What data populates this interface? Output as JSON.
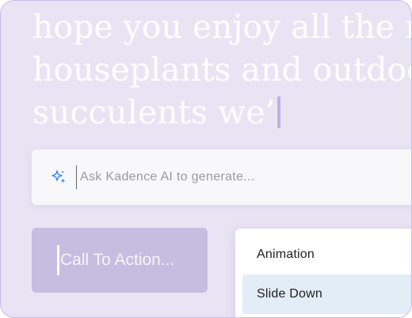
{
  "headline": {
    "lines": [
      "hope you enjoy all the new",
      "houseplants and outdoor",
      "succulents we’"
    ]
  },
  "ai_bar": {
    "icon": "sparkle-icon",
    "placeholder": "Ask Kadence AI to generate..."
  },
  "cta": {
    "label": "Call To Action..."
  },
  "dropdown": {
    "title": "Animation",
    "selected_option": "Slide Down"
  },
  "colors": {
    "background": "#e9e4f4",
    "accent_icon": "#3b82f6",
    "cta_fill": "#c6bde0",
    "selected_option_fill": "#e2edf8"
  }
}
